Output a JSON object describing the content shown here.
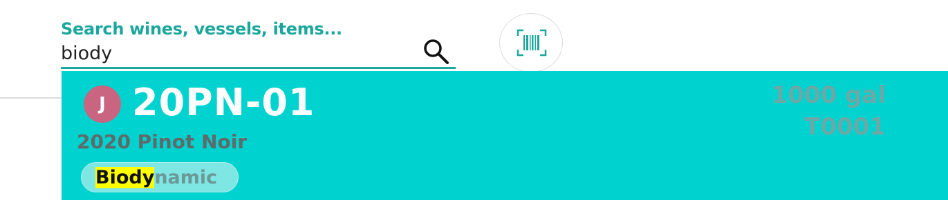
{
  "search": {
    "label": "Search wines, vessels, items...",
    "value": "biody"
  },
  "icons": {
    "search": "search-icon",
    "barcode": "barcode-scan-icon"
  },
  "result": {
    "avatar_letter": "J",
    "lot_code": "20PN-01",
    "wine_name": "2020 Pinot Noir",
    "volume": "1000 gal",
    "vessel": "T0001",
    "tag": {
      "highlighted": "Biody",
      "rest": "namic"
    }
  },
  "colors": {
    "accent": "#1ba79d",
    "card_background": "#00d2cf",
    "avatar": "#c96580",
    "highlight": "#ffff00"
  }
}
